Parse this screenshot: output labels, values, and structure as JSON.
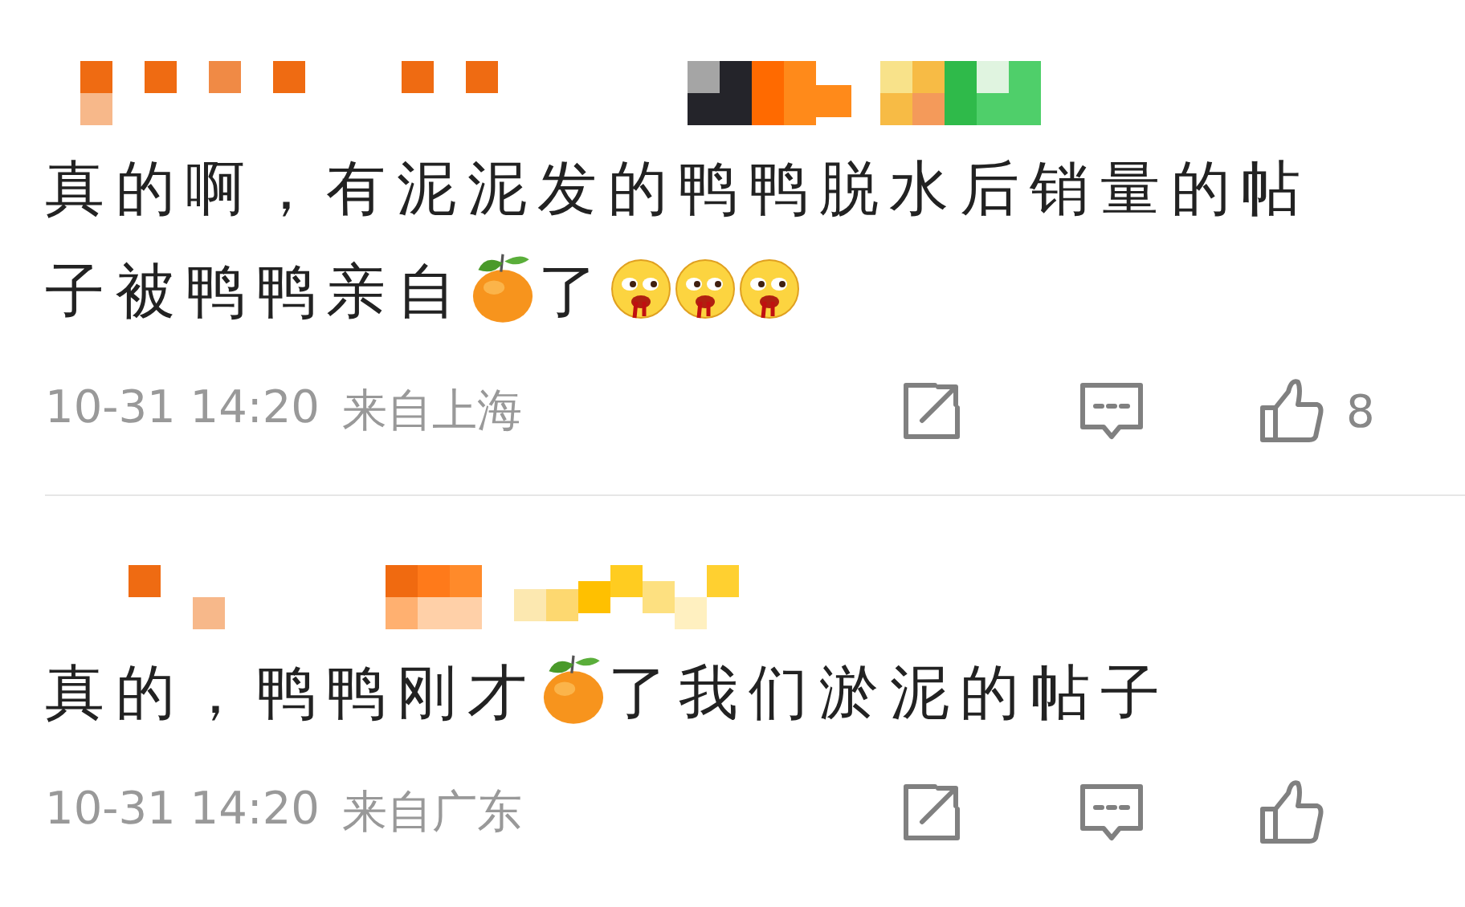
{
  "comments": [
    {
      "author": {
        "kind": "pixelated"
      },
      "content": [
        {
          "kind": "text",
          "text": "真的啊，有泥泥发的鸭鸭脱水后销量的帖"
        },
        {
          "kind": "text",
          "text": "子被鸭鸭亲自"
        },
        {
          "kind": "orange"
        },
        {
          "kind": "text",
          "text": "了"
        },
        {
          "kind": "face"
        },
        {
          "kind": "face"
        },
        {
          "kind": "face"
        }
      ],
      "time": "10-31 14:20",
      "location": "来自上海",
      "like_count": "8"
    },
    {
      "author": {
        "kind": "pixelated"
      },
      "content": [
        {
          "kind": "text",
          "text": "真的，鸭鸭刚才"
        },
        {
          "kind": "orange"
        },
        {
          "kind": "text",
          "text": "了我们淤泥的帖子"
        }
      ],
      "time": "10-31 14:20",
      "location": "来自广东"
    }
  ]
}
